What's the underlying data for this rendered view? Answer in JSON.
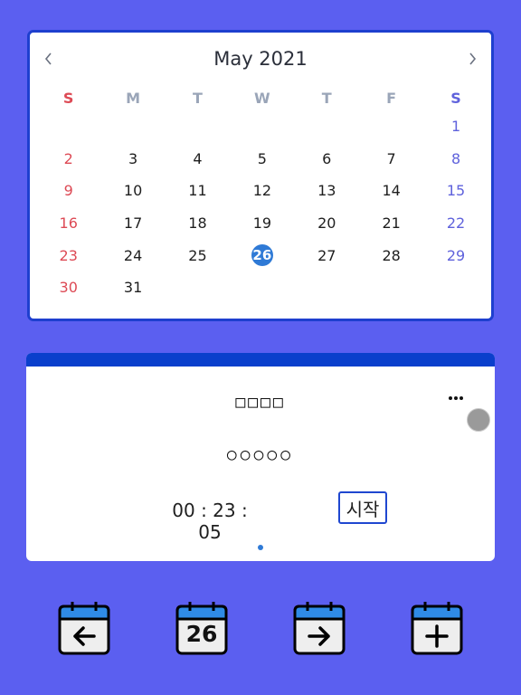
{
  "calendar": {
    "title": "May 2021",
    "prev_icon": "chevron-left-icon",
    "next_icon": "chevron-right-icon",
    "weekdays": [
      "S",
      "M",
      "T",
      "W",
      "T",
      "F",
      "S"
    ],
    "weeks": [
      [
        "",
        "",
        "",
        "",
        "",
        "",
        "1"
      ],
      [
        "2",
        "3",
        "4",
        "5",
        "6",
        "7",
        "8"
      ],
      [
        "9",
        "10",
        "11",
        "12",
        "13",
        "14",
        "15"
      ],
      [
        "16",
        "17",
        "18",
        "19",
        "20",
        "21",
        "22"
      ],
      [
        "23",
        "24",
        "25",
        "26",
        "27",
        "28",
        "29"
      ],
      [
        "30",
        "31",
        "",
        "",
        "",
        "",
        ""
      ]
    ],
    "selected_day": "26",
    "colors": {
      "sunday": "#dd4a55",
      "saturday": "#5f62dc",
      "selected": "#2f7ad6",
      "border": "#1e3fcf"
    }
  },
  "timer": {
    "title": "□□□□",
    "subtitle": "○○○○○",
    "time": "00 : 23 : 05",
    "start_label": "시작",
    "more_icon": "more-dots-icon",
    "header_color": "#0a3fcc"
  },
  "toolbar": {
    "prev_day_icon": "calendar-arrow-left-icon",
    "today_icon": "calendar-today-icon",
    "today_number": "26",
    "next_day_icon": "calendar-arrow-right-icon",
    "add_event_icon": "calendar-plus-icon"
  },
  "colors": {
    "background": "#5b5ff0",
    "accent": "#2f7ad6"
  }
}
